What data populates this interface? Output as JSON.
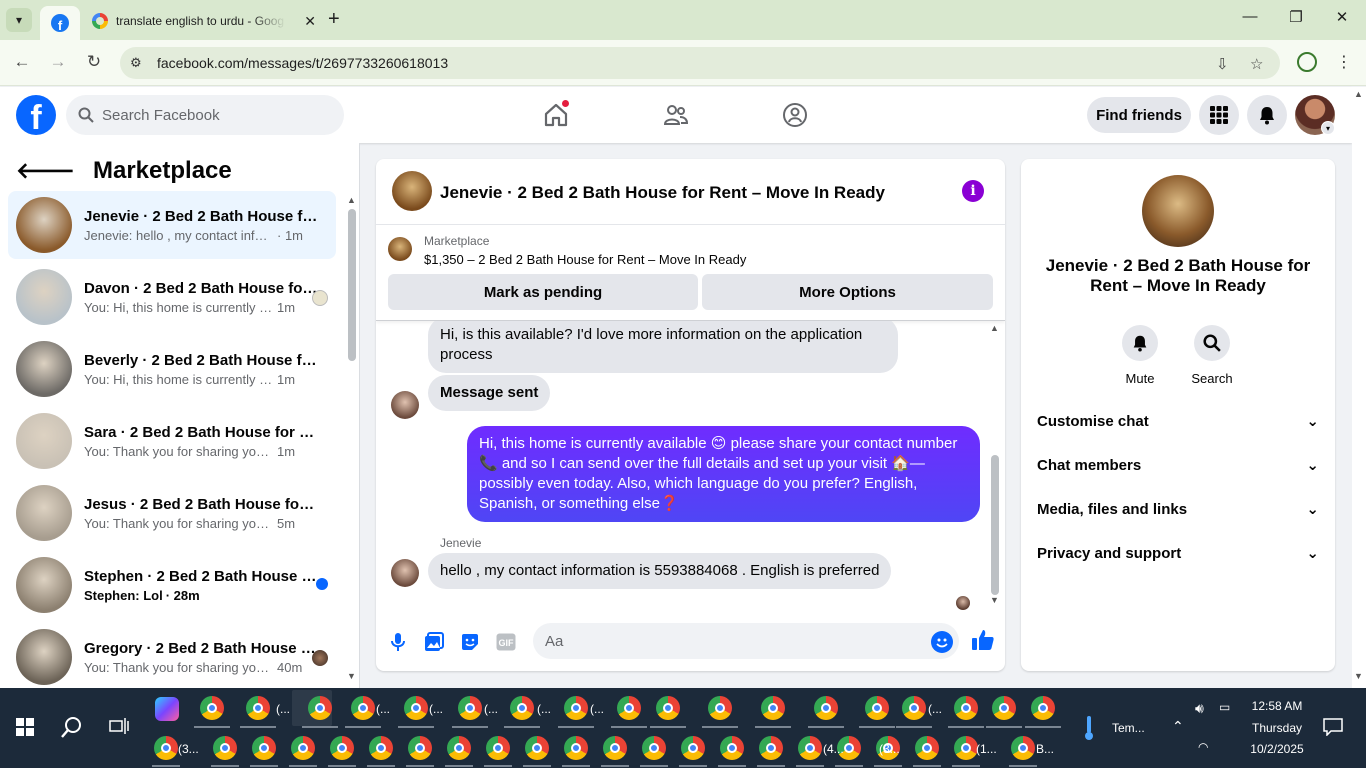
{
  "browser": {
    "tab_title": "translate english to urdu - Goog",
    "url": "facebook.com/messages/t/2697733260618013"
  },
  "fb": {
    "search_placeholder": "Search Facebook",
    "find_friends": "Find friends"
  },
  "left": {
    "title": "Marketplace",
    "chats": [
      {
        "name": "Jenevie · 2 Bed 2 Bath House for Rent – Move In Ready",
        "preview": "Jenevie: hello , my contact information is 5593884068",
        "time": "· 1m",
        "color": "#8a5a2b"
      },
      {
        "name": "Davon · 2 Bed 2 Bath House for Rent – Move In Ready",
        "preview": "You: Hi, this home is currently available",
        "time": "1m",
        "color": "#b8c2c9"
      },
      {
        "name": "Beverly · 2 Bed 2 Bath House for Rent – Move In Ready",
        "preview": "You: Hi, this home is currently available",
        "time": "1m",
        "color": "#6d6a66"
      },
      {
        "name": "Sara · 2 Bed 2 Bath House for Rent – Move In Ready",
        "preview": "You: Thank you for sharing your number",
        "time": "1m",
        "color": "#c9c1b5"
      },
      {
        "name": "Jesus · 2 Bed 2 Bath House for Rent – Move In Ready",
        "preview": "You: Thank you for sharing your number",
        "time": "5m",
        "color": "#a79d8f"
      },
      {
        "name": "Stephen · 2 Bed 2 Bath House for Rent – Move In Ready",
        "preview": "Stephen: Lol",
        "time": "· 28m",
        "color": "#8c8070"
      },
      {
        "name": "Gregory · 2 Bed 2 Bath House for Rent – Move In Ready",
        "preview": "You: Thank you for sharing your number",
        "time": "40m",
        "color": "#6c6357"
      }
    ]
  },
  "chat": {
    "title": "Jenevie · 2 Bed 2 Bath House for Rent – Move In Ready",
    "marketplace_label": "Marketplace",
    "listing": "$1,350 – 2 Bed 2 Bath House for Rent – Move In Ready",
    "mark_pending": "Mark as pending",
    "more_options": "More Options",
    "msg1": "Hi, is this available? I'd love more information on the application process",
    "msg2": "Message sent",
    "msg3": "Hi, this home is currently available 😊 please share your contact number 📞 and  so I can send over the full details and set up your visit 🏠—possibly even today. Also, which language do you prefer? English, Spanish, or something else❓",
    "sender": "Jenevie",
    "msg4": "hello , my contact information is 5593884068 . English is preferred",
    "composer_placeholder": "Aa"
  },
  "right": {
    "title": "Jenevie · 2 Bed 2 Bath House for Rent – Move In Ready",
    "mute": "Mute",
    "search": "Search",
    "rows": [
      "Customise chat",
      "Chat members",
      "Media, files and links",
      "Privacy and support"
    ]
  },
  "taskbar": {
    "weather": "Tem...",
    "time": "12:58 AM",
    "day": "Thursday",
    "date": "10/2/2025",
    "labels": [
      "(...",
      "(...",
      "(...",
      "(...",
      "(...",
      "(...",
      "(...",
      "(3...",
      "(4...",
      "(3...",
      "(1...",
      "B..."
    ]
  }
}
